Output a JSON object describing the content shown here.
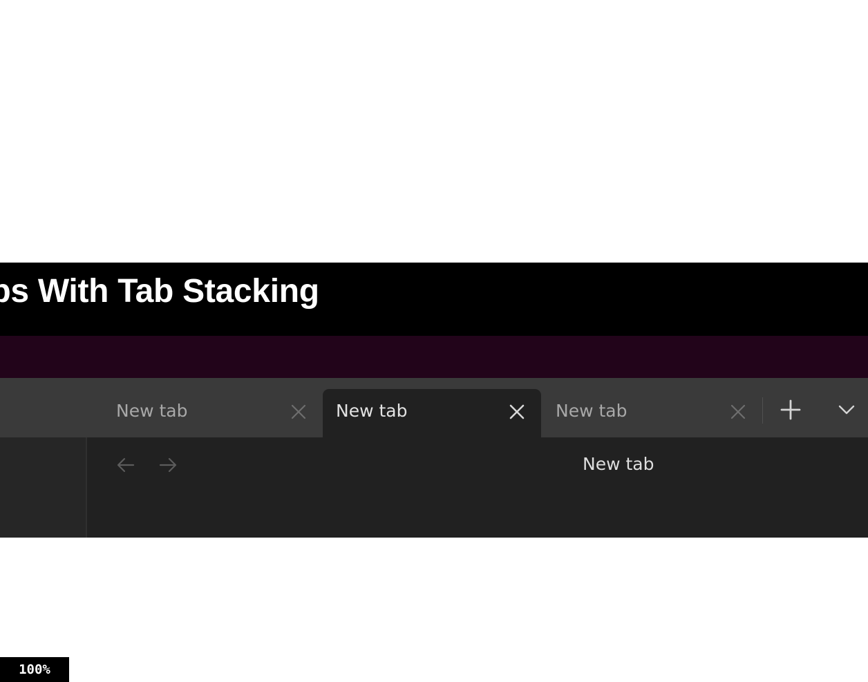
{
  "slide": {
    "title": "abs With Tab Stacking"
  },
  "browser": {
    "tabs": [
      {
        "label": "New tab",
        "active": false,
        "icon": "close-icon"
      },
      {
        "label": "New tab",
        "active": true,
        "icon": "close-icon"
      },
      {
        "label": "New tab",
        "active": false,
        "icon": "close-icon"
      }
    ],
    "new_tab_icon": "plus-icon",
    "tab_list_icon": "chevron-down-icon",
    "nav": {
      "back_icon": "arrow-left-icon",
      "forward_icon": "arrow-right-icon"
    },
    "page_title": "New tab"
  },
  "zoom": {
    "level": "100%"
  },
  "colors": {
    "title_bar": "#000000",
    "accent_band": "#22041a",
    "tabstrip": "#3a3a3a",
    "content": "#212121"
  }
}
